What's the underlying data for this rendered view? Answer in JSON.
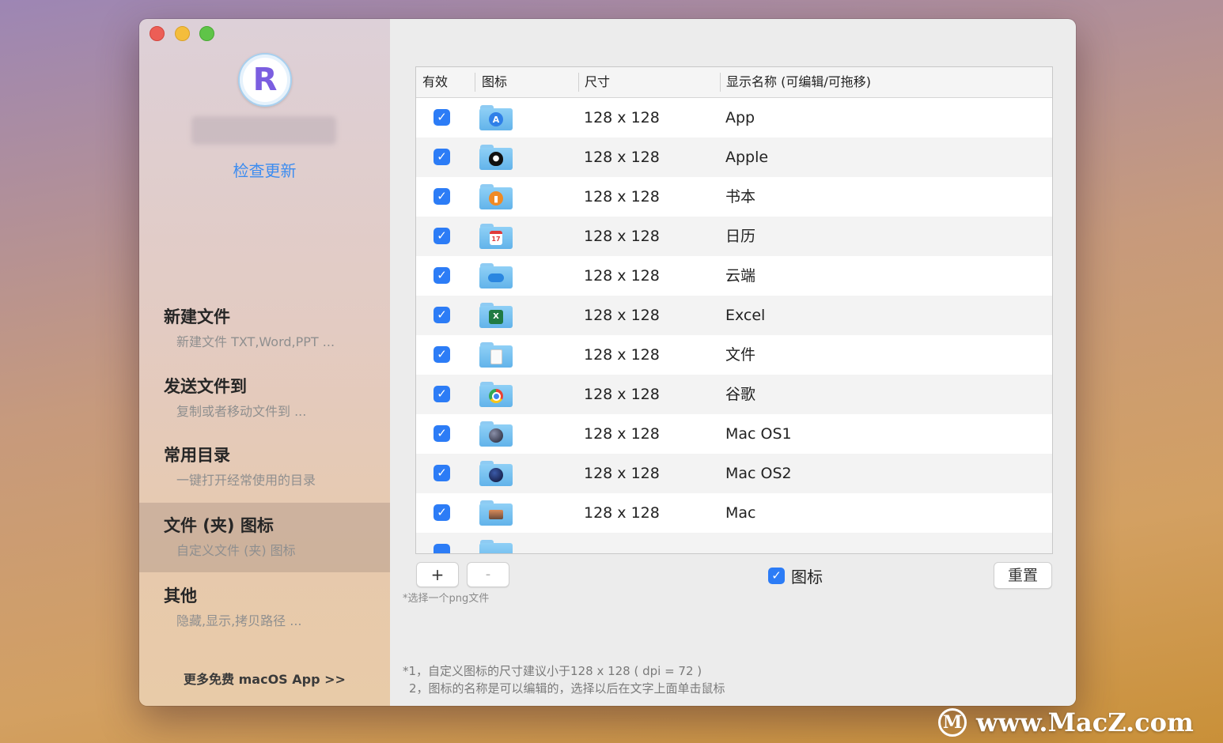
{
  "sidebar": {
    "check_update": "检查更新",
    "logo_letter": "R",
    "items": [
      {
        "title": "新建文件",
        "subtitle": "新建文件 TXT,Word,PPT ...",
        "selected": false
      },
      {
        "title": "发送文件到",
        "subtitle": "复制或者移动文件到 ...",
        "selected": false
      },
      {
        "title": "常用目录",
        "subtitle": "一键打开经常使用的目录",
        "selected": false
      },
      {
        "title": "文件 (夹) 图标",
        "subtitle": "自定义文件 (夹) 图标",
        "selected": true
      },
      {
        "title": "其他",
        "subtitle": "隐藏,显示,拷贝路径 ...",
        "selected": false
      }
    ],
    "more_apps": "更多免费 macOS App >>"
  },
  "table": {
    "headers": {
      "enabled": "有效",
      "icon": "图标",
      "size": "尺寸",
      "name": "显示名称 (可编辑/可拖移)"
    },
    "rows": [
      {
        "enabled": true,
        "icon": "app-store-folder-icon",
        "size": "128 x 128",
        "name": "App"
      },
      {
        "enabled": true,
        "icon": "apple-folder-icon",
        "size": "128 x 128",
        "name": "Apple"
      },
      {
        "enabled": true,
        "icon": "books-folder-icon",
        "size": "128 x 128",
        "name": "书本"
      },
      {
        "enabled": true,
        "icon": "calendar-folder-icon",
        "size": "128 x 128",
        "name": "日历"
      },
      {
        "enabled": true,
        "icon": "cloud-folder-icon",
        "size": "128 x 128",
        "name": "云端"
      },
      {
        "enabled": true,
        "icon": "excel-folder-icon",
        "size": "128 x 128",
        "name": "Excel"
      },
      {
        "enabled": true,
        "icon": "document-folder-icon",
        "size": "128 x 128",
        "name": "文件"
      },
      {
        "enabled": true,
        "icon": "chrome-folder-icon",
        "size": "128 x 128",
        "name": "谷歌"
      },
      {
        "enabled": true,
        "icon": "macos1-folder-icon",
        "size": "128 x 128",
        "name": "Mac OS1"
      },
      {
        "enabled": true,
        "icon": "macos2-folder-icon",
        "size": "128 x 128",
        "name": "Mac OS2"
      },
      {
        "enabled": true,
        "icon": "mac-folder-icon",
        "size": "128 x 128",
        "name": "Mac"
      }
    ]
  },
  "controls": {
    "add_label": "+",
    "remove_label": "-",
    "hint": "*选择一个png文件",
    "icon_toggle_label": "图标",
    "reset_label": "重置"
  },
  "notes": {
    "line1": "*1，自定义图标的尺寸建议小于128 x 128 ( dpi = 72 )",
    "line2": "2，图标的名称是可以编辑的，选择以后在文字上面单击鼠标"
  },
  "watermark": {
    "logo": "M",
    "text": "www.MacZ.com"
  },
  "colors": {
    "accent": "#2c7cf6",
    "link": "#3c8cf0",
    "folder": "#62b3ea"
  }
}
